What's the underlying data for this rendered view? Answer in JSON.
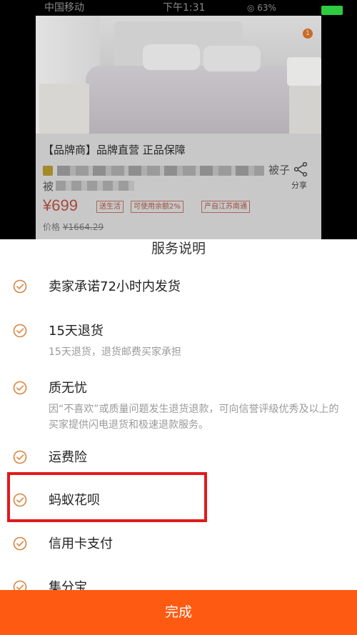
{
  "status_bar": {
    "carrier": "中国移动",
    "time": "下午1:31",
    "right": "◎ 63%"
  },
  "product": {
    "cart_badge": "1",
    "brand_line": "【品牌商】品牌直营 正品保障",
    "title_tail": "被子",
    "title_line2_start": "被",
    "share_label": "分享",
    "price": "¥699",
    "tags": [
      "送生活",
      "可使用余额2%",
      "产自江苏南通"
    ],
    "original_price_label": "价格",
    "original_price": "¥1664.29"
  },
  "sheet": {
    "title": "服务说明",
    "items": [
      {
        "title": "卖家承诺72小时内发货",
        "desc": ""
      },
      {
        "title": "15天退货",
        "desc": "15天退货，退货邮费买家承担"
      },
      {
        "title": "质无忧",
        "desc": "因“不喜欢”或质量问题发生退货退款，可向信誉评级优秀及以上的买家提供闪电退货和极速退款服务。"
      },
      {
        "title": "运费险",
        "desc": ""
      },
      {
        "title": "蚂蚁花呗",
        "desc": ""
      },
      {
        "title": "信用卡支付",
        "desc": ""
      },
      {
        "title": "集分宝",
        "desc": ""
      }
    ],
    "done_label": "完成"
  },
  "colors": {
    "accent": "#ff5a12",
    "check_icon": "#d9843f",
    "highlight": "#e2191a"
  }
}
